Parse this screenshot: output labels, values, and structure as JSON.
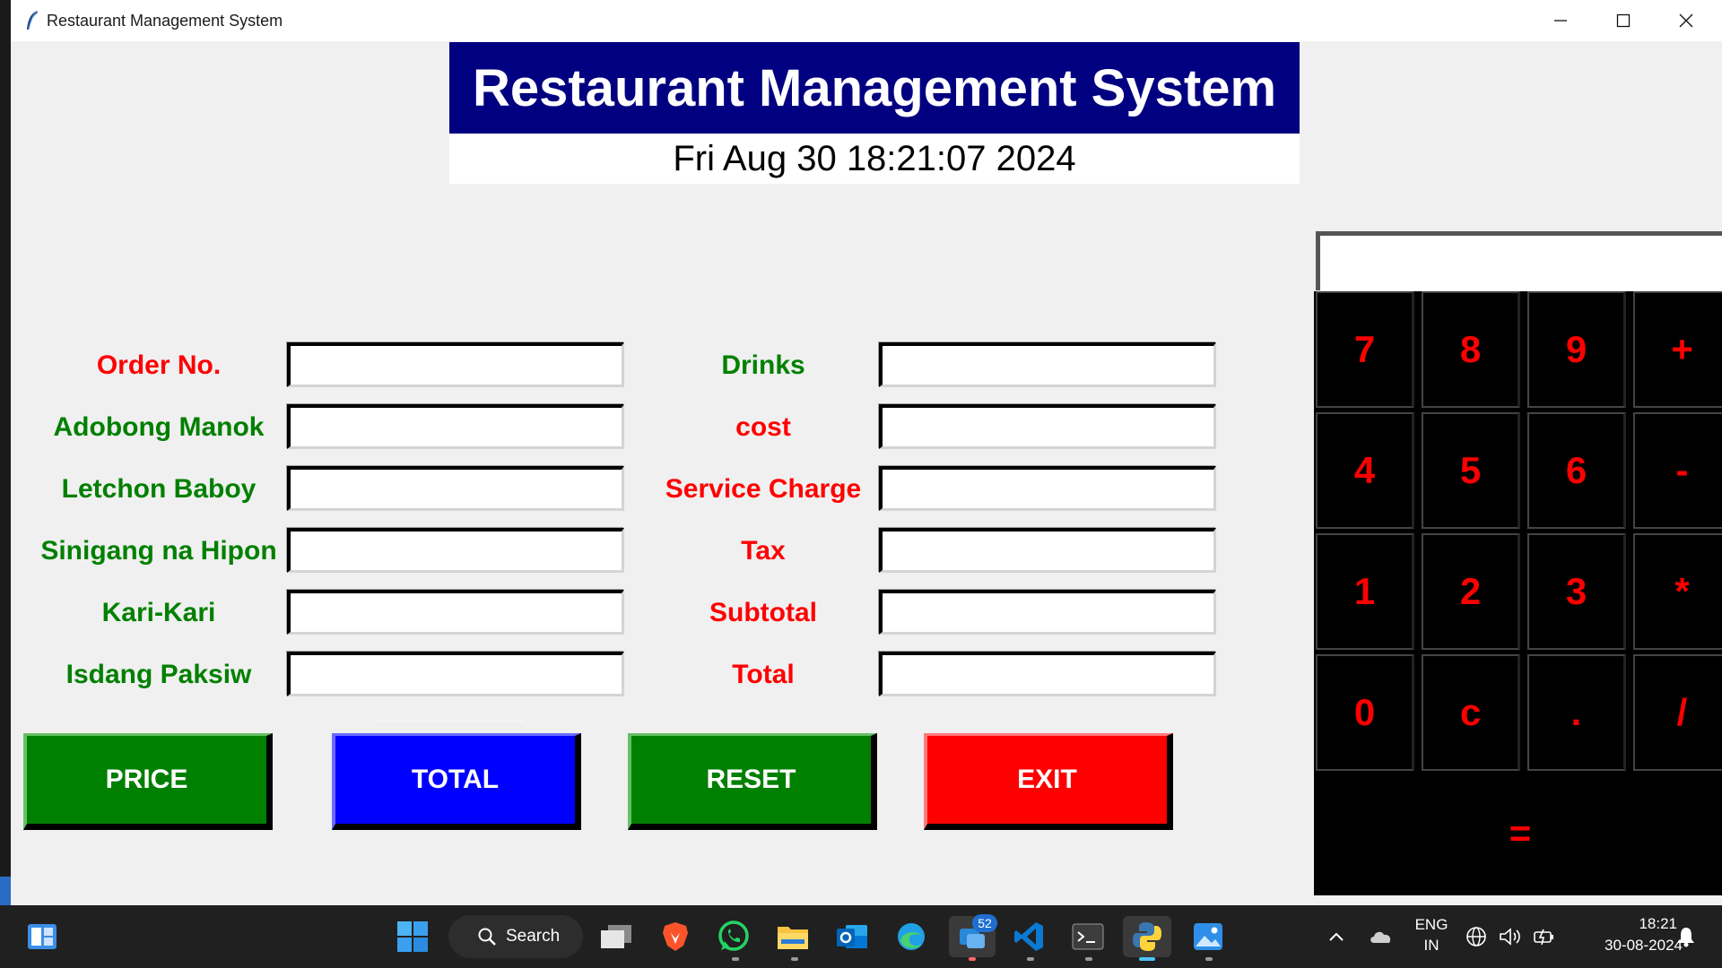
{
  "window": {
    "title": "Restaurant Management System",
    "controls": [
      "minimize",
      "maximize",
      "close"
    ]
  },
  "header": {
    "title": "Restaurant Management System",
    "datetime": "Fri Aug 30 18:21:07 2024"
  },
  "form": {
    "left": [
      {
        "label": "Order No.",
        "color": "#ff0000",
        "value": ""
      },
      {
        "label": "Adobong Manok",
        "color": "#008000",
        "value": ""
      },
      {
        "label": "Letchon Baboy",
        "color": "#008000",
        "value": ""
      },
      {
        "label": "Sinigang na Hipon",
        "color": "#008000",
        "value": ""
      },
      {
        "label": "Kari-Kari",
        "color": "#008000",
        "value": ""
      },
      {
        "label": "Isdang Paksiw",
        "color": "#008000",
        "value": ""
      }
    ],
    "right": [
      {
        "label": "Drinks",
        "color": "#008000",
        "value": ""
      },
      {
        "label": "cost",
        "color": "#ff0000",
        "value": ""
      },
      {
        "label": "Service Charge",
        "color": "#ff0000",
        "value": ""
      },
      {
        "label": "Tax",
        "color": "#ff0000",
        "value": ""
      },
      {
        "label": "Subtotal",
        "color": "#ff0000",
        "value": ""
      },
      {
        "label": "Total",
        "color": "#ff0000",
        "value": ""
      }
    ]
  },
  "buttons": [
    {
      "label": "PRICE",
      "color": "#008000"
    },
    {
      "label": "TOTAL",
      "color": "#0000ff"
    },
    {
      "label": "RESET",
      "color": "#008000"
    },
    {
      "label": "EXIT",
      "color": "#ff0000"
    }
  ],
  "calculator": {
    "display": "",
    "keys": [
      [
        "7",
        "8",
        "9",
        "+"
      ],
      [
        "4",
        "5",
        "6",
        "-"
      ],
      [
        "1",
        "2",
        "3",
        "*"
      ],
      [
        "0",
        "c",
        ".",
        "/"
      ]
    ],
    "equals": "="
  },
  "taskbar": {
    "search_label": "Search",
    "badge": "52",
    "lang_line1": "ENG",
    "lang_line2": "IN",
    "time": "18:21",
    "date": "30-08-2024"
  }
}
